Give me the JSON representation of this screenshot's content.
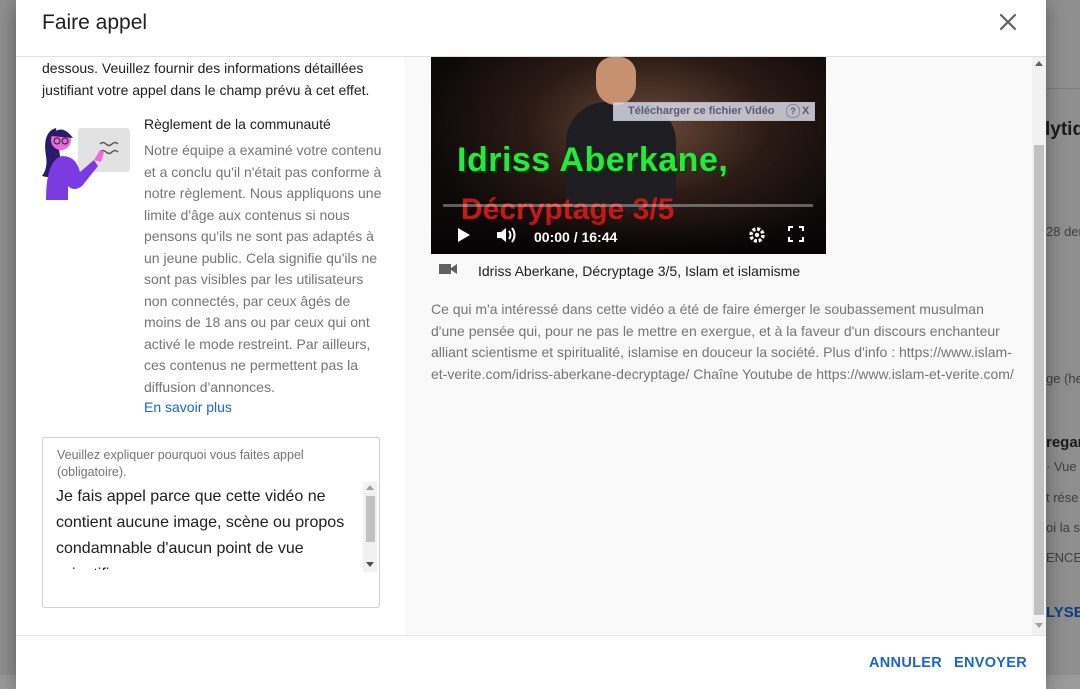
{
  "background": {
    "title_fragment": "lytiq",
    "date_fragment": "28 der",
    "paren_fragment": "ge (he",
    "regar_fragment": "regar",
    "vue_fragment": "· Vue",
    "rese_fragment": "t rése",
    "oila_fragment": "oi la s",
    "ence_fragment": "ENCE",
    "analyse_fragment": "LYSE"
  },
  "dialog": {
    "title": "Faire appel",
    "intro_text": "dessous. Veuillez fournir des informations détaillées justifiant votre appel dans le champ prévu à cet effet.",
    "guideline": {
      "title": "Règlement de la communauté",
      "text": "Notre équipe a examiné votre contenu et a conclu qu'il n'était pas conforme à notre règlement. Nous appliquons une limite d'âge aux contenus si nous pensons qu'ils ne sont pas adaptés à un jeune public. Cela signifie qu'ils ne sont pas visibles par les utilisateurs non connectés, par ceux âgés de moins de 18 ans ou par ceux qui ont activé le mode restreint. Par ailleurs, ces contenus ne permettent pas la diffusion d'annonces.",
      "learn_more": "En savoir plus"
    },
    "appeal_field": {
      "label": "Veuillez expliquer pourquoi vous faites appel (obligatoire).",
      "value": "Je fais appel parce que cette vidéo ne contient aucune image, scène ou propos condamnable d'aucun point de vue scientifique"
    },
    "video": {
      "download_bar": "Télécharger ce fichier Vidéo",
      "download_help": "?",
      "download_close": "X",
      "overlay_line1": "Idriss Aberkane,",
      "overlay_line2": "Décryptage 3/5",
      "time": "00:00 / 16:44",
      "progress": 0,
      "title": "Idriss Aberkane, Décryptage 3/5, Islam et islamisme",
      "description": "Ce qui m'a intéressé dans cette vidéo a été de faire émerger le soubassement musulman d'une pensée qui, pour ne pas le mettre en exergue, et à la faveur d'un discours enchanteur alliant scientisme et spiritualité, islamise en douceur la société. Plus d'info : https://www.islam-et-verite.com/idriss-aberkane-decryptage/ Chaîne Youtube de https://www.islam-et-verite.com/"
    },
    "footer": {
      "cancel": "ANNULER",
      "send": "ENVOYER"
    }
  },
  "colors": {
    "accent": "#1a65c8",
    "overlay_green": "#27e83b",
    "overlay_red": "#c01b1b"
  }
}
